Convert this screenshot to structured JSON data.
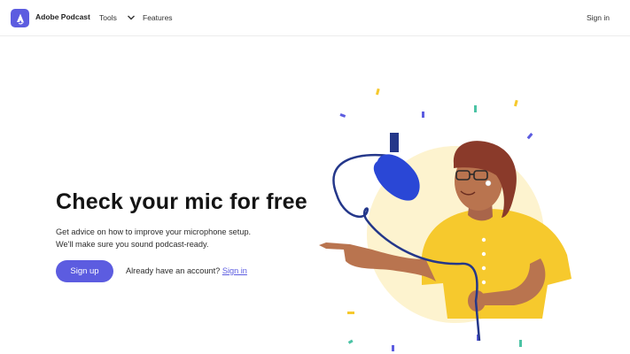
{
  "brand": {
    "name": "Adobe Podcast",
    "logo_icon": "adobe-podcast-logo",
    "accent": "#5c5ce0"
  },
  "nav": {
    "tools_label": "Tools",
    "features_label": "Features",
    "signin_label": "Sign in"
  },
  "hero": {
    "title": "Check your mic for free",
    "subtitle_line1": "Get advice on how to improve your microphone setup.",
    "subtitle_line2": "We'll make sure you sound podcast-ready.",
    "signup_label": "Sign up",
    "account_prompt": "Already have an account?",
    "account_signin_label": "Sign in"
  },
  "illustration": {
    "description_icon": "podcaster-with-microphone",
    "colors": {
      "shirt": "#f6c92d",
      "skin": "#b9744f",
      "hair": "#8a3a2a",
      "mic": "#2a47d6",
      "glow": "#fdf3cf"
    }
  }
}
